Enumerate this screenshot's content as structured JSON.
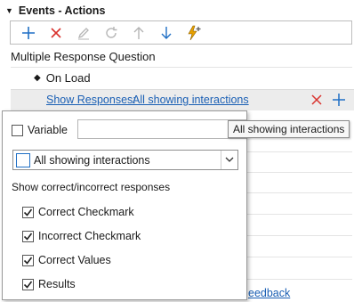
{
  "header": {
    "title": "Events - Actions"
  },
  "toolbar": {
    "buttons": [
      {
        "icon": "plus-icon",
        "color": "#1f6fc5"
      },
      {
        "icon": "close-icon",
        "color": "#d9322e"
      },
      {
        "icon": "pencil-icon",
        "color": "#b5b5b5"
      },
      {
        "icon": "refresh-icon",
        "color": "#b5b5b5"
      },
      {
        "icon": "arrow-up-icon",
        "color": "#b5b5b5"
      },
      {
        "icon": "arrow-down-icon",
        "color": "#1f6fc5"
      },
      {
        "icon": "lightning-add-icon",
        "color": "#e8a100"
      }
    ]
  },
  "tree": {
    "object_title": "Multiple Response Question",
    "event_label": "On Load",
    "action": {
      "label": "Show Responses:",
      "value": "All showing interactions"
    },
    "footer_link": "eedback"
  },
  "tooltip": {
    "text": "All showing interactions"
  },
  "popup": {
    "variable": {
      "label": "Variable",
      "checked": false,
      "value": ""
    },
    "dropdown": {
      "selected": "All showing interactions"
    },
    "section_label": "Show correct/incorrect responses",
    "options": [
      {
        "label": "Correct Checkmark",
        "checked": true
      },
      {
        "label": "Incorrect Checkmark",
        "checked": true
      },
      {
        "label": "Correct Values",
        "checked": true
      },
      {
        "label": "Results",
        "checked": true
      }
    ]
  },
  "colors": {
    "link": "#1a5fb4",
    "accent": "#1f6fc5",
    "danger": "#d9322e",
    "selected_row": "#ececec"
  }
}
